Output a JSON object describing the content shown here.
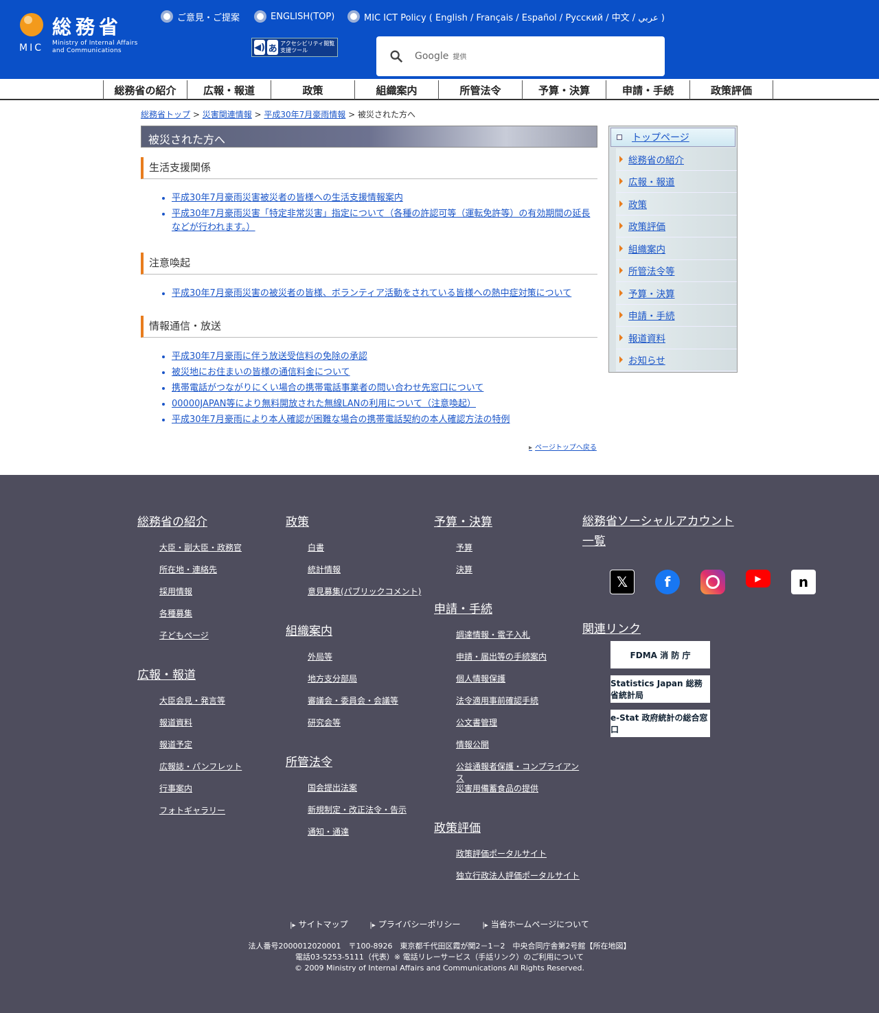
{
  "header": {
    "logo_jp": "総務省",
    "logo_mic": "MIC",
    "logo_en1": "Ministry of Internal Affairs",
    "logo_en2": "and Communications",
    "links": [
      "ご意見・ご提案",
      "ENGLISH(TOP)",
      "MIC ICT Policy ( English / Français / Español / Русский / 中文 / عربي )"
    ],
    "accessibility": "アクセシビリティ閲覧支援ツール",
    "search_brand": "Google",
    "search_sub": "提供"
  },
  "gnav": [
    "総務省の紹介",
    "広報・報道",
    "政策",
    "組織案内",
    "所管法令",
    "予算・決算",
    "申請・手続",
    "政策評価"
  ],
  "breadcrumb": {
    "items": [
      "総務省トップ",
      "災害関連情報",
      "平成30年7月豪雨情報"
    ],
    "current": "被災された方へ"
  },
  "main": {
    "title": "被災された方へ",
    "sections": [
      {
        "heading": "生活支援関係",
        "links": [
          "平成30年7月豪雨災害被災者の皆様への生活支援情報案内",
          "平成30年7月豪雨災害「特定非常災害」指定について（各種の許認可等（運転免許等）の有効期間の延長などが行われます。）"
        ]
      },
      {
        "heading": "注意喚起",
        "links": [
          "平成30年7月豪雨災害の被災者の皆様、ボランティア活動をされている皆様への熱中症対策について"
        ]
      },
      {
        "heading": "情報通信・放送",
        "links": [
          "平成30年7月豪雨に伴う放送受信料の免除の承認",
          "被災地にお住まいの皆様の通信料金について",
          "携帯電話がつながりにくい場合の携帯電話事業者の問い合わせ先窓口について",
          "00000JAPAN等により無料開放された無線LANの利用について（注意喚起）",
          "平成30年7月豪雨により本人確認が困難な場合の携帯電話契約の本人確認方法の特例"
        ]
      }
    ],
    "pagetop": "ページトップへ戻る"
  },
  "side": {
    "top": "トップページ",
    "items": [
      "総務省の紹介",
      "広報・報道",
      "政策",
      "政策評価",
      "組織案内",
      "所管法令等",
      "予算・決算",
      "申請・手続",
      "報道資料",
      "お知らせ"
    ]
  },
  "footer": {
    "col1": [
      {
        "h": "総務省の紹介",
        "items": [
          "大臣・副大臣・政務官",
          "所在地・連絡先",
          "採用情報",
          "各種募集",
          "子どもページ"
        ]
      },
      {
        "h": "広報・報道",
        "items": [
          "大臣会見・発言等",
          "報道資料",
          "報道予定",
          "広報誌・パンフレット",
          "行事案内",
          "フォトギャラリー"
        ]
      }
    ],
    "col2": [
      {
        "h": "政策",
        "items": [
          "白書",
          "統計情報",
          "意見募集(パブリックコメント)"
        ]
      },
      {
        "h": "組織案内",
        "items": [
          "外局等",
          "地方支分部局",
          "審議会・委員会・会議等",
          "研究会等"
        ]
      },
      {
        "h": "所管法令",
        "items": [
          "国会提出法案",
          "新規制定・改正法令・告示",
          "通知・通達"
        ]
      }
    ],
    "col3": [
      {
        "h": "予算・決算",
        "items": [
          "予算",
          "決算"
        ]
      },
      {
        "h": "申請・手続",
        "items": [
          "調達情報・電子入札",
          "申請・届出等の手続案内",
          "個人情報保護",
          "法令適用事前確認手続",
          "公文書管理",
          "情報公開",
          "公益通報者保護・コンプライアンス",
          "災害用備蓄食品の提供"
        ]
      },
      {
        "h": "政策評価",
        "items": [
          "政策評価ポータルサイト",
          "独立行政法人評価ポータルサイト"
        ]
      }
    ],
    "social_heading": "総務省ソーシャルアカウント一覧",
    "related_heading": "関連リンク",
    "banners": [
      "FDMA 消 防 庁",
      "Statistics Japan 総務省統計局",
      "e-Stat 政府統計の総合窓口"
    ],
    "bottom_links": [
      "サイトマップ",
      "プライバシーポリシー",
      "当省ホームページについて"
    ],
    "addr1": "法人番号2000012020001　〒100-8926　東京都千代田区霞が関2－1－2　中央合同庁舎第2号館【所在地図】",
    "addr2": "電話03-5253-5111（代表）※ 電話リレーサービス（手話リンク）のご利用について",
    "copyright": "© 2009 Ministry of Internal Affairs and Communications All Rights Reserved."
  }
}
